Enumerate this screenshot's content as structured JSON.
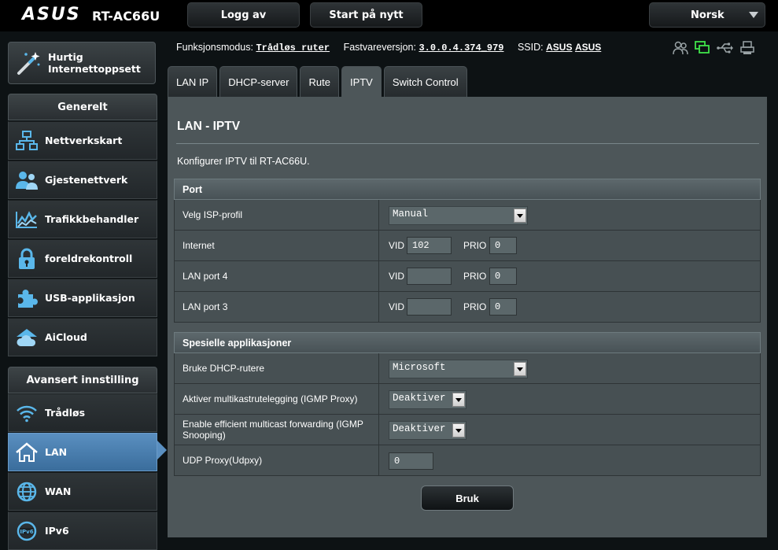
{
  "header": {
    "logo": "ASUS",
    "model": "RT-AC66U",
    "logout": "Logg av",
    "restart": "Start på nytt",
    "language": "Norsk"
  },
  "status": {
    "mode_label": "Funksjonsmodus:",
    "mode_value": "Trådløs ruter",
    "fw_label": "Fastvareversjon:",
    "fw_value": "3.0.0.4.374_979",
    "ssid_label": "SSID:",
    "ssid_1": "ASUS",
    "ssid_2": "ASUS",
    "icons": [
      "clients-icon",
      "network-status-icon",
      "usb-icon",
      "printer-icon"
    ]
  },
  "sidebar": {
    "quick_setup": [
      "Hurtig",
      "Internettoppsett"
    ],
    "general_title": "Generelt",
    "general_items": [
      {
        "label": "Nettverkskart",
        "icon": "network-map-icon"
      },
      {
        "label": "Gjestenettverk",
        "icon": "guest-network-icon"
      },
      {
        "label": "Trafikkbehandler",
        "icon": "traffic-manager-icon"
      },
      {
        "label": "foreldrekontroll",
        "icon": "parental-lock-icon"
      },
      {
        "label": "USB-applikasjon",
        "icon": "puzzle-icon"
      },
      {
        "label": "AiCloud",
        "icon": "cloud-icon"
      }
    ],
    "advanced_title": "Avansert innstilling",
    "advanced_items": [
      {
        "label": "Trådløs",
        "icon": "wifi-icon"
      },
      {
        "label": "LAN",
        "icon": "home-icon"
      },
      {
        "label": "WAN",
        "icon": "globe-icon"
      },
      {
        "label": "IPv6",
        "icon": "ipv6-globe-icon"
      }
    ],
    "active_item": "LAN"
  },
  "tabs": [
    "LAN IP",
    "DHCP-server",
    "Rute",
    "IPTV",
    "Switch Control"
  ],
  "active_tab": "IPTV",
  "page": {
    "title": "LAN - IPTV",
    "description": "Konfigurer IPTV til RT-AC66U."
  },
  "port_section": {
    "title": "Port",
    "isp_profile_label": "Velg ISP-profil",
    "isp_profile_value": "Manual",
    "vid_label": "VID",
    "prio_label": "PRIO",
    "rows": [
      {
        "label": "Internet",
        "vid": "102",
        "prio": "0"
      },
      {
        "label": "LAN port 4",
        "vid": "",
        "prio": "0"
      },
      {
        "label": "LAN port 3",
        "vid": "",
        "prio": "0"
      }
    ]
  },
  "special_section": {
    "title": "Spesielle applikasjoner",
    "dhcp_router_label": "Bruke DHCP-rutere",
    "dhcp_router_value": "Microsoft",
    "igmp_proxy_label": "Aktiver multikastrutelegging (IGMP Proxy)",
    "igmp_proxy_value": "Deaktiver",
    "igmp_snooping_label": "Enable efficient multicast forwarding (IGMP Snooping)",
    "igmp_snooping_value": "Deaktiver",
    "udpxy_label": "UDP Proxy(Udpxy)",
    "udpxy_value": "0"
  },
  "apply_label": "Bruk"
}
